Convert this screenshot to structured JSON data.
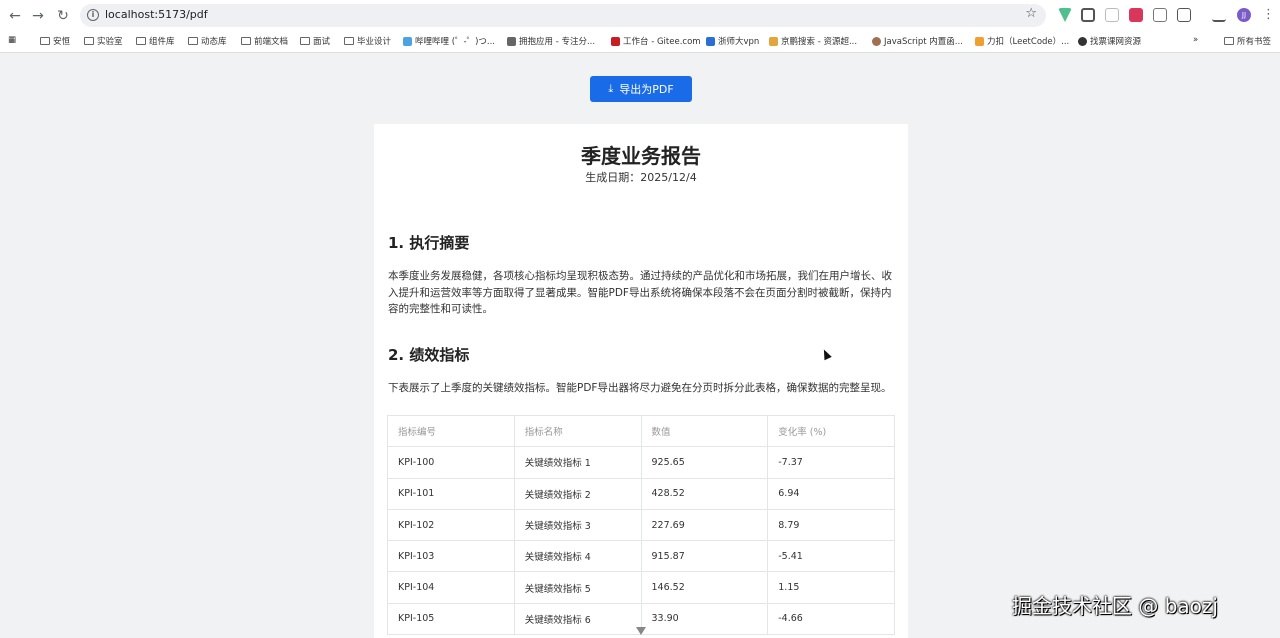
{
  "browser": {
    "url": "localhost:5173/pdf",
    "profile_initial": "JJ",
    "bookmarks": [
      "安恒",
      "实验室",
      "组件库",
      "动态库",
      "前端文档",
      "面试",
      "毕业设计",
      "哔哩哔哩 (゜-゜)つ...",
      "拥抱应用 - 专注分...",
      "工作台 - Gitee.com",
      "浙师大vpn",
      "京鹏搜索 - 资源超...",
      "JavaScript 内置函...",
      "力扣（LeetCode）...",
      "找票课网资源"
    ],
    "more_bookmarks": "»",
    "all_bookmarks": "所有书签"
  },
  "page": {
    "export_label": "导出为PDF",
    "title": "季度业务报告",
    "date": "生成日期：2025/12/4",
    "section1_heading": "1. 执行摘要",
    "section1_text": "本季度业务发展稳健，各项核心指标均呈现积极态势。通过持续的产品优化和市场拓展，我们在用户增长、收入提升和运营效率等方面取得了显著成果。智能PDF导出系统将确保本段落不会在页面分割时被截断，保持内容的完整性和可读性。",
    "section2_heading": "2. 绩效指标",
    "section2_text": "下表展示了上季度的关键绩效指标。智能PDF导出器将尽力避免在分页时拆分此表格，确保数据的完整呈现。"
  },
  "table": {
    "headers": [
      "指标编号",
      "指标名称",
      "数值",
      "变化率 (%)"
    ],
    "rows": [
      [
        "KPI-100",
        "关键绩效指标 1",
        "925.65",
        "-7.37"
      ],
      [
        "KPI-101",
        "关键绩效指标 2",
        "428.52",
        "6.94"
      ],
      [
        "KPI-102",
        "关键绩效指标 3",
        "227.69",
        "8.79"
      ],
      [
        "KPI-103",
        "关键绩效指标 4",
        "915.87",
        "-5.41"
      ],
      [
        "KPI-104",
        "关键绩效指标 5",
        "146.52",
        "1.15"
      ],
      [
        "KPI-105",
        "关键绩效指标 6",
        "33.90",
        "-4.66"
      ]
    ]
  },
  "watermark": "掘金技术社区 @ baozj",
  "colors": {
    "primary": "#1a6be8",
    "page_bg": "#f1f2f4"
  }
}
